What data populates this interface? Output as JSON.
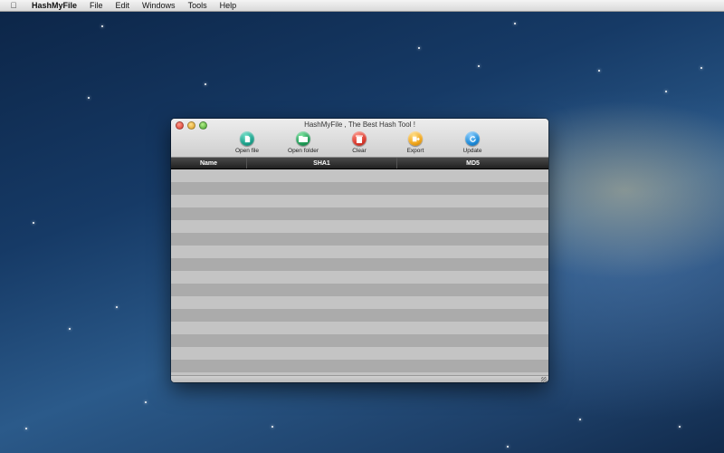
{
  "menubar": {
    "apple_icon": "apple-logo-icon",
    "items": [
      {
        "label": "HashMyFile",
        "bold": true
      },
      {
        "label": "File"
      },
      {
        "label": "Edit"
      },
      {
        "label": "Windows"
      },
      {
        "label": "Tools"
      },
      {
        "label": "Help"
      }
    ]
  },
  "window": {
    "title": "HashMyFile  ,  The  Best Hash Tool !",
    "toolbar": [
      {
        "label": "Open file",
        "icon": "open-file-icon",
        "color": "#1aa08a"
      },
      {
        "label": "Open folder",
        "icon": "open-folder-icon",
        "color": "#1e9a55"
      },
      {
        "label": "Clear",
        "icon": "trash-icon",
        "color": "#d8382c"
      },
      {
        "label": "Export",
        "icon": "export-icon",
        "color": "#f0a418"
      },
      {
        "label": "Update",
        "icon": "refresh-icon",
        "color": "#1c8ad8"
      }
    ],
    "columns": [
      "Name",
      "SHA1",
      "MD5"
    ],
    "rows": []
  }
}
